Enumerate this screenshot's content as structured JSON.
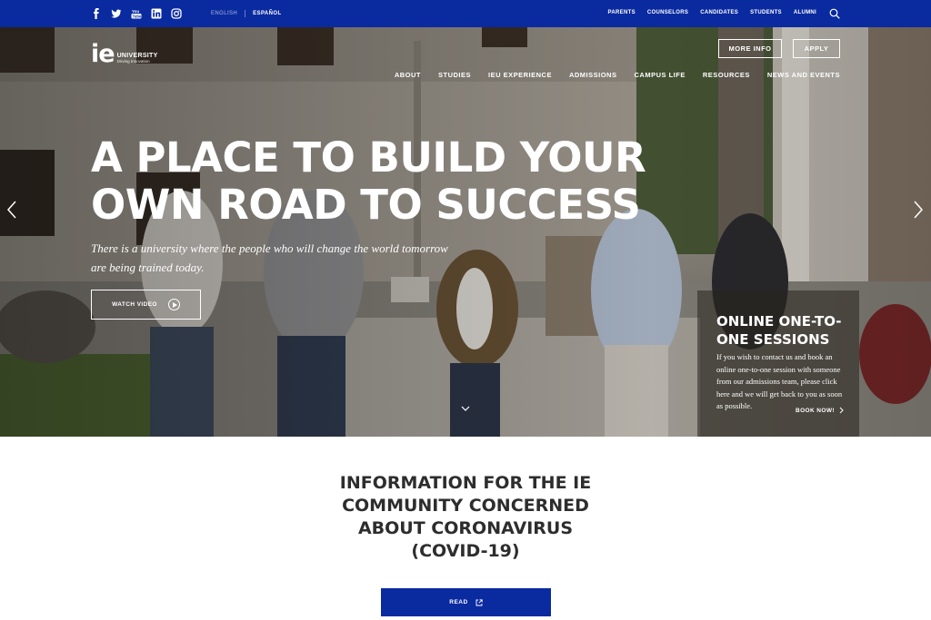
{
  "topbar": {
    "social_icons": [
      "facebook-icon",
      "twitter-icon",
      "youtube-icon",
      "linkedin-icon",
      "instagram-icon"
    ],
    "languages": [
      {
        "label": "ENGLISH",
        "active": false
      },
      {
        "label": "ESPAÑOL",
        "active": true
      }
    ],
    "audience_links": [
      "PARENTS",
      "COUNSELORS",
      "CANDIDATES",
      "STUDENTS",
      "ALUMNI"
    ],
    "search_icon": "search-icon"
  },
  "header": {
    "logo_mark": "ie",
    "logo_name": "UNIVERSITY",
    "logo_tagline": "Driving Innovation",
    "more_info_label": "MORE INFO",
    "apply_label": "APPLY",
    "nav": [
      "ABOUT",
      "STUDIES",
      "IEU EXPERIENCE",
      "ADMISSIONS",
      "CAMPUS LIFE",
      "RESOURCES",
      "NEWS AND EVENTS"
    ]
  },
  "hero": {
    "headline_line1": "A PLACE TO BUILD YOUR",
    "headline_line2": "OWN ROAD TO SUCCESS",
    "tagline": "There is a university where the people who will change the world tomorrow are being trained today.",
    "watch_video_label": "WATCH VIDEO"
  },
  "promo": {
    "title": "ONLINE ONE-TO-ONE SESSIONS",
    "body": "If you wish to contact us and book an online one-to-one session with someone from our admissions team, please click here and we will get back to you as soon as possible.",
    "cta_label": "BOOK NOW!"
  },
  "info": {
    "title": "INFORMATION FOR THE IE COMMUNITY CONCERNED ABOUT CORONAVIRUS (COVID-19)",
    "read_label": "READ"
  },
  "colors": {
    "brand_blue": "#0a2aa0",
    "white": "#ffffff",
    "heading_gray": "#2d2d2d"
  }
}
